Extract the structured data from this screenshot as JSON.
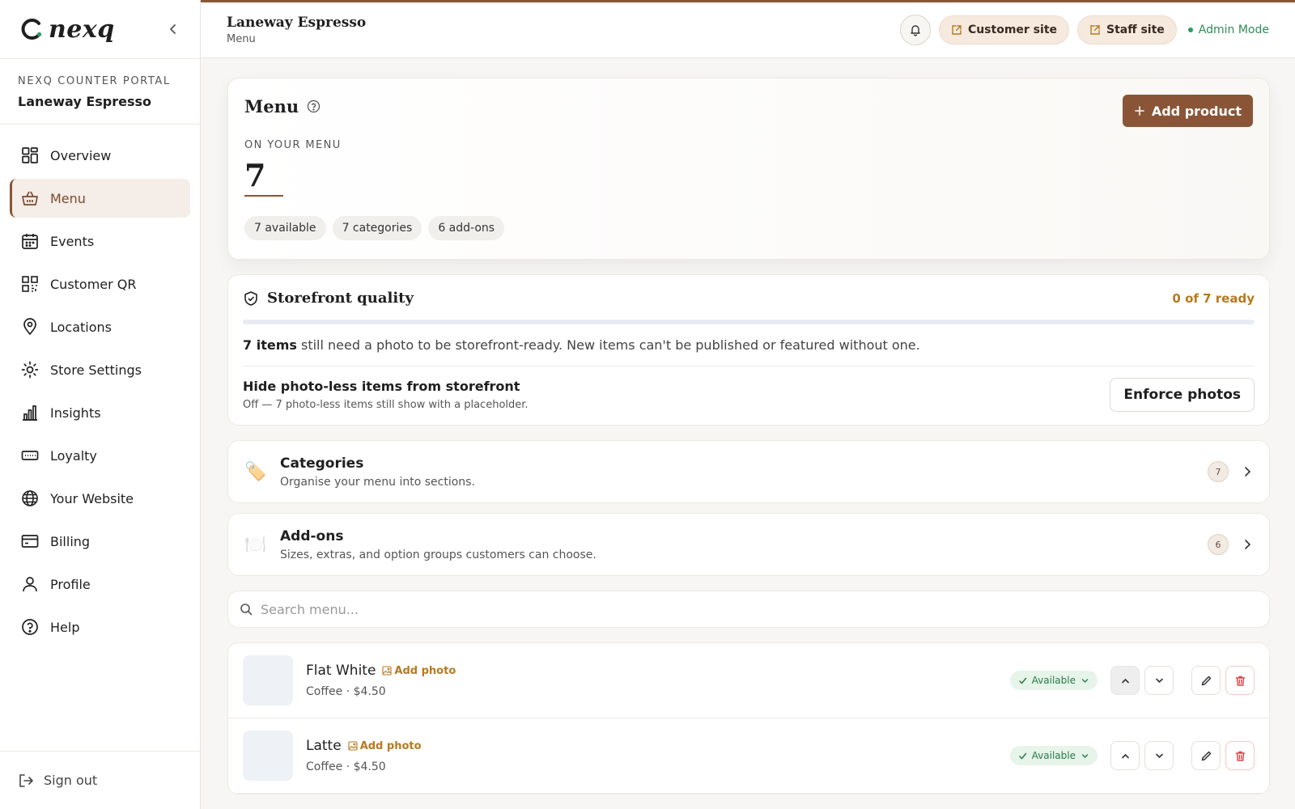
{
  "brand": {
    "name": "nexq"
  },
  "portal": {
    "label": "NEXQ COUNTER PORTAL",
    "store": "Laneway Espresso"
  },
  "nav": [
    {
      "label": "Overview",
      "icon": "grid-icon"
    },
    {
      "label": "Menu",
      "icon": "basket-icon",
      "active": true
    },
    {
      "label": "Events",
      "icon": "calendar-icon"
    },
    {
      "label": "Customer QR",
      "icon": "qr-icon"
    },
    {
      "label": "Locations",
      "icon": "pin-icon"
    },
    {
      "label": "Store Settings",
      "icon": "sun-gear-icon"
    },
    {
      "label": "Insights",
      "icon": "bar-chart-icon"
    },
    {
      "label": "Loyalty",
      "icon": "card-icon"
    },
    {
      "label": "Your Website",
      "icon": "globe-icon"
    },
    {
      "label": "Billing",
      "icon": "credit-card-icon"
    },
    {
      "label": "Profile",
      "icon": "user-icon"
    },
    {
      "label": "Help",
      "icon": "help-icon"
    }
  ],
  "signout": "Sign out",
  "topbar": {
    "title": "Laneway Espresso",
    "subtitle": "Menu",
    "customer_site": "Customer site",
    "staff_site": "Staff site",
    "admin_mode": "Admin Mode"
  },
  "hero": {
    "title": "Menu",
    "add_product": "Add product",
    "on_label": "ON YOUR MENU",
    "count": "7",
    "chips": [
      "7 available",
      "7 categories",
      "6 add-ons"
    ]
  },
  "quality": {
    "title": "Storefront quality",
    "ready": "0 of 7 ready",
    "progress": 0,
    "msg_bold": "7 items",
    "msg_rest": " still need a photo to be storefront-ready. New items can't be published or featured without one.",
    "hide_title": "Hide photo-less items from storefront",
    "hide_sub": "Off — 7 photo-less items still show with a placeholder.",
    "enforce": "Enforce photos"
  },
  "categories": {
    "title": "Categories",
    "sub": "Organise your menu into sections.",
    "count": "7",
    "emoji": "🏷️"
  },
  "addons": {
    "title": "Add-ons",
    "sub": "Sizes, extras, and option groups customers can choose.",
    "count": "6",
    "emoji": "🍽️"
  },
  "search": {
    "placeholder": "Search menu..."
  },
  "items": [
    {
      "name": "Flat White",
      "add_photo": "Add photo",
      "meta": "Coffee · $4.50",
      "status": "Available"
    },
    {
      "name": "Latte",
      "add_photo": "Add photo",
      "meta": "Coffee · $4.50",
      "status": "Available"
    }
  ]
}
